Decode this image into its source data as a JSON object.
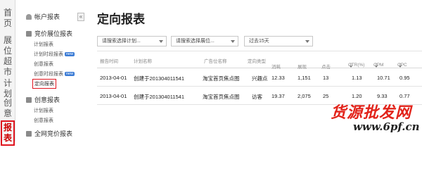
{
  "left_nav": [
    {
      "label": "首页",
      "active": false
    },
    {
      "label": "展位超市",
      "active": false
    },
    {
      "label": "计划",
      "active": false
    },
    {
      "label": "创意",
      "active": false
    },
    {
      "label": "报表",
      "active": true
    }
  ],
  "sidebar": {
    "account_report": "帐户报表",
    "bid_report": "竞价展位报表",
    "bid_items": [
      {
        "label": "计划报表",
        "badge": ""
      },
      {
        "label": "计划时段报表",
        "badge": "new"
      },
      {
        "label": "创意报表",
        "badge": ""
      },
      {
        "label": "创意时段报表",
        "badge": "new"
      },
      {
        "label": "定向报表",
        "badge": ""
      }
    ],
    "create_report": "创意报表",
    "create_items": [
      {
        "label": "计划报表",
        "badge": ""
      },
      {
        "label": "创意报表",
        "badge": ""
      }
    ],
    "all_network": "全网竞价报表",
    "collapse": "«"
  },
  "main": {
    "title": "定向报表",
    "filters": {
      "plan_select": "请搜索选择计划...",
      "position_select": "请搜索选择展位...",
      "date_select": "过去15天"
    },
    "columns": [
      "报告时间",
      "计划名称",
      "广告位名称",
      "定向类型",
      "消耗",
      "展现",
      "点击",
      "CTR(%)",
      "CPM",
      "CPC"
    ],
    "rows": [
      [
        "2013-04-01",
        "创建于201304011541",
        "淘宝首页焦点图",
        "兴趣点",
        "12.33",
        "1,151",
        "13",
        "1.13",
        "10.71",
        "0.95"
      ],
      [
        "2013-04-01",
        "创建于201304011541",
        "淘宝首页焦点图",
        "访客",
        "19.37",
        "2,075",
        "25",
        "1.20",
        "9.33",
        "0.77"
      ]
    ]
  },
  "watermark": {
    "line1": "货源批发网",
    "line2": "www.6pf.cn"
  }
}
